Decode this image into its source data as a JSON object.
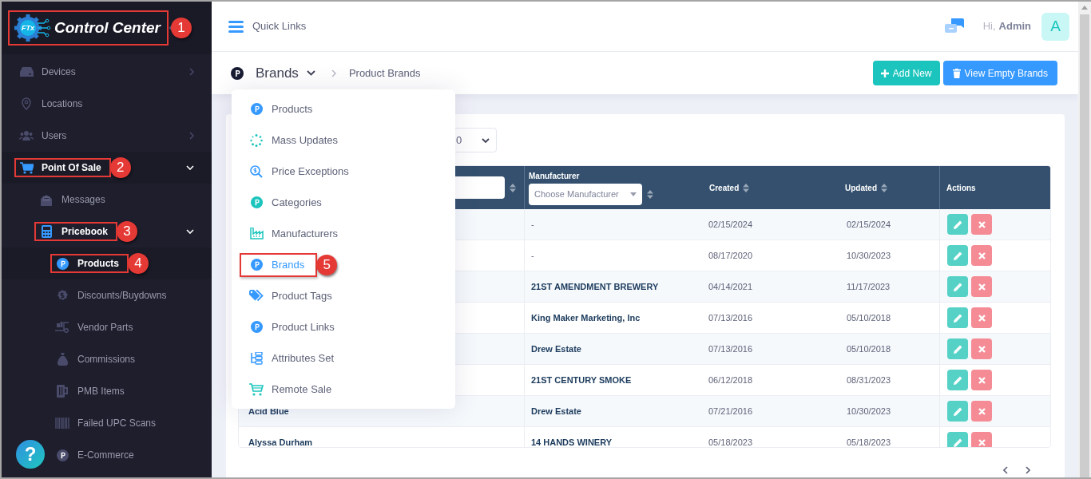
{
  "sidebar": {
    "logo": {
      "badge": "FTx",
      "text": "Control Center",
      "callout": "1"
    },
    "items": [
      {
        "label": "Devices",
        "expanded": false,
        "selected": false
      },
      {
        "label": "Locations",
        "selected": false
      },
      {
        "label": "Users",
        "expanded": false,
        "selected": false
      },
      {
        "label": "Point Of Sale",
        "expanded": true,
        "selected": true,
        "callout": "2",
        "children": [
          {
            "label": "Messages",
            "selected": false
          },
          {
            "label": "Pricebook",
            "expanded": true,
            "selected": true,
            "callout": "3",
            "children": [
              {
                "label": "Products",
                "selected": true,
                "callout": "4"
              },
              {
                "label": "Discounts/Buydowns",
                "selected": false
              },
              {
                "label": "Vendor Parts",
                "selected": false
              },
              {
                "label": "Commissions",
                "selected": false
              },
              {
                "label": "PMB Items",
                "selected": false
              },
              {
                "label": "Failed UPC Scans",
                "selected": false
              },
              {
                "label": "E-Commerce",
                "selected": false
              }
            ]
          }
        ]
      }
    ]
  },
  "topbar": {
    "quick_links": "Quick Links",
    "greeting": "Hi,",
    "user": "Admin",
    "avatar": "A"
  },
  "breadcrumb": {
    "title": "Brands",
    "page": "Product Brands"
  },
  "actions": [
    "Add New",
    "View Empty Brands"
  ],
  "menu": [
    {
      "label": "Products",
      "selected": false
    },
    {
      "label": "Mass Updates",
      "selected": false
    },
    {
      "label": "Price Exceptions",
      "selected": false
    },
    {
      "label": "Categories",
      "selected": false
    },
    {
      "label": "Manufacturers",
      "selected": false
    },
    {
      "label": "Brands",
      "selected": true,
      "callout": "5"
    },
    {
      "label": "Product Tags",
      "selected": false
    },
    {
      "label": "Product Links",
      "selected": false
    },
    {
      "label": "Attributes Set",
      "selected": false
    },
    {
      "label": "Remote Sale",
      "selected": false
    }
  ],
  "page_size": "0",
  "table": {
    "columns": [
      "Manufacturer",
      "Created",
      "Updated",
      "Actions"
    ],
    "manufacturer_filter": {
      "placeholder": "Choose Manufacturer"
    },
    "rows": [
      {
        "manufacturer": "-",
        "created": "02/15/2024",
        "updated": "02/15/2024"
      },
      {
        "manufacturer": "-",
        "created": "08/17/2020",
        "updated": "10/30/2023"
      },
      {
        "manufacturer": "21ST AMENDMENT BREWERY",
        "created": "04/14/2021",
        "updated": "11/17/2023"
      },
      {
        "manufacturer": "King Maker Marketing, Inc",
        "created": "07/13/2016",
        "updated": "05/10/2018"
      },
      {
        "manufacturer": "Drew Estate",
        "created": "07/13/2016",
        "updated": "05/10/2018"
      },
      {
        "manufacturer": "21ST CENTURY SMOKE",
        "created": "06/12/2018",
        "updated": "08/31/2023"
      },
      {
        "name": "Acid Blue",
        "manufacturer": "Drew Estate",
        "created": "07/21/2016",
        "updated": "10/30/2023"
      },
      {
        "name": "Alyssa Durham",
        "manufacturer": "14 HANDS WINERY",
        "created": "05/18/2023",
        "updated": "05/18/2023"
      }
    ]
  },
  "help": "?"
}
